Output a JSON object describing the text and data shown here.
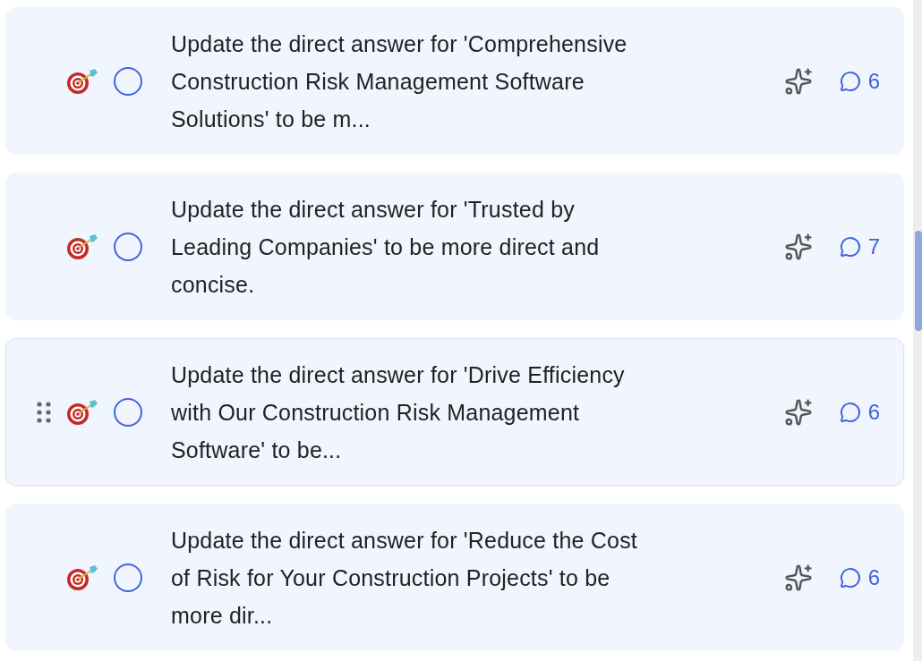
{
  "tasks": [
    {
      "title_lines": [
        "Update the direct answer for 'Comprehensive",
        "Construction Risk Management Software",
        "Solutions' to be m..."
      ],
      "checked": false,
      "hovered": false,
      "comments": "6"
    },
    {
      "title_lines": [
        "Update the direct answer for 'Trusted by",
        "Leading Companies' to be more direct and",
        "concise."
      ],
      "checked": false,
      "hovered": false,
      "comments": "7"
    },
    {
      "title_lines": [
        "Update the direct answer for 'Drive Efficiency",
        "with Our Construction Risk Management",
        "Software' to be..."
      ],
      "checked": false,
      "hovered": true,
      "comments": "6"
    },
    {
      "title_lines": [
        "Update the direct answer for 'Reduce the Cost",
        "of Risk for Your Construction Projects' to be",
        "more dir..."
      ],
      "checked": false,
      "hovered": false,
      "comments": "6"
    }
  ]
}
